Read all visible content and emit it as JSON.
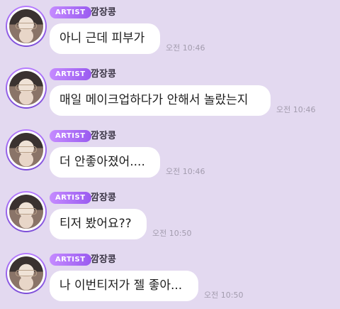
{
  "messages": [
    {
      "badge": "ARTIST",
      "name": "깜장콩",
      "text": "아니 근데 피부가",
      "time": "오전 10:46"
    },
    {
      "badge": "ARTIST",
      "name": "깜장콩",
      "text": "매일 메이크업하다가 안해서 놀랐는지",
      "time": "오전 10:46"
    },
    {
      "badge": "ARTIST",
      "name": "깜장콩",
      "text": "더 안좋아졌어....",
      "time": "오전 10:46"
    },
    {
      "badge": "ARTIST",
      "name": "깜장콩",
      "text": "티저 봤어요??",
      "time": "오전 10:50"
    },
    {
      "badge": "ARTIST",
      "name": "깜장콩",
      "text": "나 이번티저가 젤 좋아...",
      "time": "오전 10:50"
    }
  ]
}
